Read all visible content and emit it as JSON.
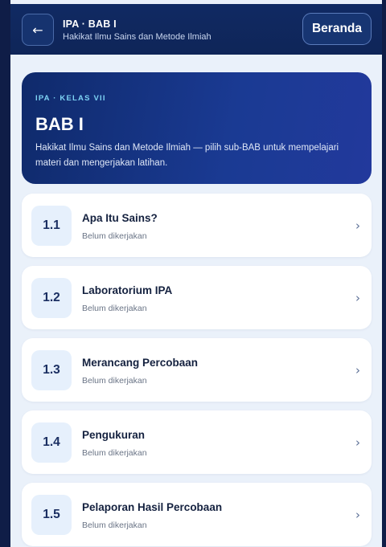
{
  "header": {
    "back_icon": "←",
    "title": "IPA · BAB I",
    "subtitle": "Hakikat Ilmu Sains dan Metode Ilmiah",
    "home_label": "Beranda"
  },
  "hero": {
    "kicker": "IPA · KELAS VII",
    "title": "BAB I",
    "description": "Hakikat Ilmu Sains dan Metode Ilmiah — pilih sub-BAB untuk mempelajari materi dan mengerjakan latihan."
  },
  "subchapters": [
    {
      "number": "1.1",
      "title": "Apa Itu Sains?",
      "status": "Belum dikerjakan"
    },
    {
      "number": "1.2",
      "title": "Laboratorium IPA",
      "status": "Belum dikerjakan"
    },
    {
      "number": "1.3",
      "title": "Merancang Percobaan",
      "status": "Belum dikerjakan"
    },
    {
      "number": "1.4",
      "title": "Pengukuran",
      "status": "Belum dikerjakan"
    },
    {
      "number": "1.5",
      "title": "Pelaporan Hasil Percobaan",
      "status": "Belum dikerjakan"
    }
  ],
  "chevron": "›",
  "colors": {
    "page_bg": "#eaf1fa",
    "header_bg": "#102a63",
    "hero_bg": "#1a3a93",
    "kicker": "#7ed3f4",
    "number_badge_bg": "#e6f0fc"
  }
}
